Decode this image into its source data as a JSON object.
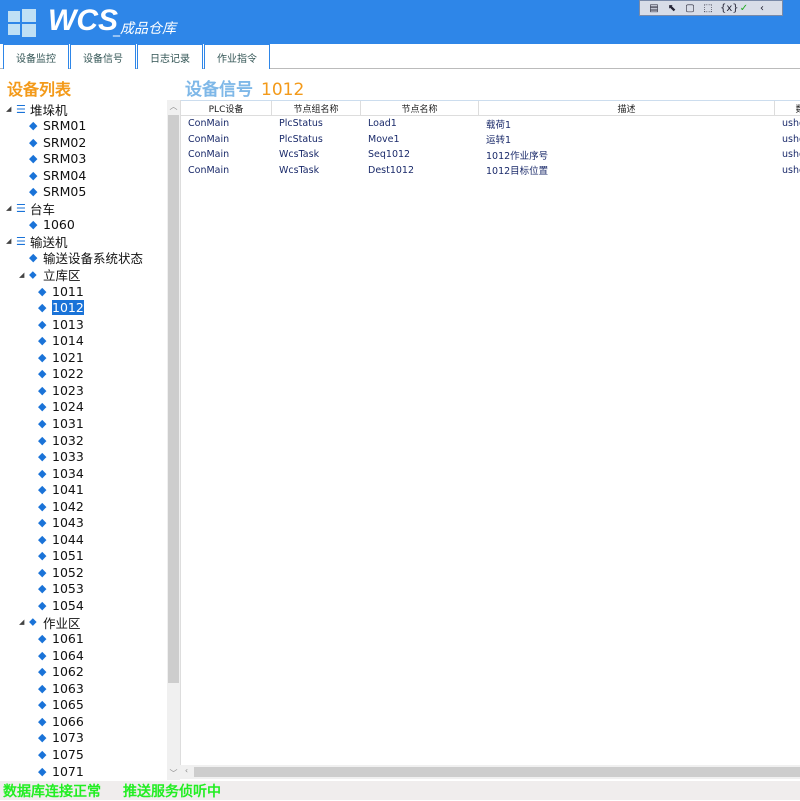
{
  "header": {
    "title": "WCS",
    "subtitle": "_成品仓库"
  },
  "devtools": {
    "icons": [
      "live-tree-icon",
      "select-element-icon",
      "layout-adorner-icon",
      "track-focus-icon",
      "binding-icon",
      "check-icon",
      "collapse-icon"
    ],
    "glyphs": [
      "▤",
      "⬉",
      "▢",
      "⬚",
      "{x}",
      "✓",
      "‹"
    ]
  },
  "tabs": [
    {
      "label": "设备监控"
    },
    {
      "label": "设备信号"
    },
    {
      "label": "日志记录"
    },
    {
      "label": "作业指令"
    }
  ],
  "sidebar": {
    "title": "设备列表"
  },
  "tree": [
    {
      "label": "堆垛机",
      "level": 0,
      "type": "list",
      "expanded": true
    },
    {
      "label": "SRM01",
      "level": 1,
      "type": "tag"
    },
    {
      "label": "SRM02",
      "level": 1,
      "type": "tag"
    },
    {
      "label": "SRM03",
      "level": 1,
      "type": "tag"
    },
    {
      "label": "SRM04",
      "level": 1,
      "type": "tag"
    },
    {
      "label": "SRM05",
      "level": 1,
      "type": "tag"
    },
    {
      "label": "台车",
      "level": 0,
      "type": "list",
      "expanded": true
    },
    {
      "label": "1060",
      "level": 1,
      "type": "tag"
    },
    {
      "label": "输送机",
      "level": 0,
      "type": "list",
      "expanded": true
    },
    {
      "label": "输送设备系统状态",
      "level": 1,
      "type": "tag"
    },
    {
      "label": "立库区",
      "level": 1,
      "type": "tags",
      "expanded": true
    },
    {
      "label": "1011",
      "level": 2,
      "type": "tag"
    },
    {
      "label": "1012",
      "level": 2,
      "type": "tag",
      "selected": true
    },
    {
      "label": "1013",
      "level": 2,
      "type": "tag"
    },
    {
      "label": "1014",
      "level": 2,
      "type": "tag"
    },
    {
      "label": "1021",
      "level": 2,
      "type": "tag"
    },
    {
      "label": "1022",
      "level": 2,
      "type": "tag"
    },
    {
      "label": "1023",
      "level": 2,
      "type": "tag"
    },
    {
      "label": "1024",
      "level": 2,
      "type": "tag"
    },
    {
      "label": "1031",
      "level": 2,
      "type": "tag"
    },
    {
      "label": "1032",
      "level": 2,
      "type": "tag"
    },
    {
      "label": "1033",
      "level": 2,
      "type": "tag"
    },
    {
      "label": "1034",
      "level": 2,
      "type": "tag"
    },
    {
      "label": "1041",
      "level": 2,
      "type": "tag"
    },
    {
      "label": "1042",
      "level": 2,
      "type": "tag"
    },
    {
      "label": "1043",
      "level": 2,
      "type": "tag"
    },
    {
      "label": "1044",
      "level": 2,
      "type": "tag"
    },
    {
      "label": "1051",
      "level": 2,
      "type": "tag"
    },
    {
      "label": "1052",
      "level": 2,
      "type": "tag"
    },
    {
      "label": "1053",
      "level": 2,
      "type": "tag"
    },
    {
      "label": "1054",
      "level": 2,
      "type": "tag"
    },
    {
      "label": "作业区",
      "level": 1,
      "type": "tags",
      "expanded": true
    },
    {
      "label": "1061",
      "level": 2,
      "type": "tag"
    },
    {
      "label": "1064",
      "level": 2,
      "type": "tag"
    },
    {
      "label": "1062",
      "level": 2,
      "type": "tag"
    },
    {
      "label": "1063",
      "level": 2,
      "type": "tag"
    },
    {
      "label": "1065",
      "level": 2,
      "type": "tag"
    },
    {
      "label": "1066",
      "level": 2,
      "type": "tag"
    },
    {
      "label": "1073",
      "level": 2,
      "type": "tag"
    },
    {
      "label": "1075",
      "level": 2,
      "type": "tag"
    },
    {
      "label": "1071",
      "level": 2,
      "type": "tag"
    }
  ],
  "main": {
    "title": "设备信号",
    "device": "1012",
    "columns": [
      "PLC设备",
      "节点组名称",
      "节点名称",
      "描述",
      "数据"
    ],
    "rows": [
      [
        "ConMain",
        "PlcStatus",
        "Load1",
        "载荷1",
        "ushort"
      ],
      [
        "ConMain",
        "PlcStatus",
        "Move1",
        "运转1",
        "ushort"
      ],
      [
        "ConMain",
        "WcsTask",
        "Seq1012",
        "1012作业序号",
        "ushort"
      ],
      [
        "ConMain",
        "WcsTask",
        "Dest1012",
        "1012目标位置",
        "ushort"
      ]
    ]
  },
  "status": {
    "db": "数据库连接正常",
    "push": "推送服务侦听中"
  }
}
